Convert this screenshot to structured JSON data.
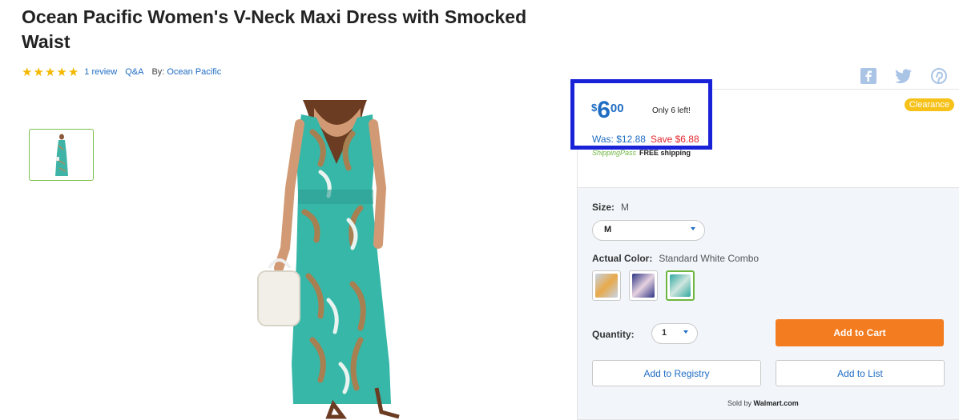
{
  "product": {
    "title": "Ocean Pacific Women's V-Neck Maxi Dress with Smocked Waist",
    "rating": 5,
    "review_link": "1 review",
    "qa_link": "Q&A",
    "by_label": "By:",
    "brand": "Ocean Pacific"
  },
  "social": {
    "icons": [
      "facebook-icon",
      "twitter-icon",
      "pinterest-icon"
    ],
    "color": "#aac4e6"
  },
  "buybox": {
    "badge": "Clearance",
    "price": {
      "currency": "$",
      "dollars": "6",
      "cents": "00"
    },
    "stock_note": "Only 6 left!",
    "was_price": "Was: $12.88",
    "savings": "Save $6.88",
    "shipping_brand": "ShippingPass",
    "shipping_text": "FREE shipping",
    "size_label": "Size:",
    "size_value": "M",
    "size_selected": "M",
    "color_label": "Actual Color:",
    "color_value": "Standard White Combo",
    "swatches": [
      {
        "colors": [
          "#c5d5e8",
          "#e8a94a"
        ]
      },
      {
        "colors": [
          "#2d3585",
          "#e6d2e0"
        ]
      },
      {
        "colors": [
          "#2fa9a0",
          "#cfe6df"
        ]
      }
    ],
    "selected_swatch": 2,
    "quantity_label": "Quantity:",
    "quantity_value": "1",
    "add_to_cart": "Add to Cart",
    "add_to_registry": "Add to Registry",
    "add_to_list": "Add to List",
    "sold_by_label": "Sold by",
    "seller": "Walmart.com"
  },
  "colors": {
    "accent_blue": "#1f6dc2",
    "cart_orange": "#f47c20",
    "save_red": "#e1262c",
    "highlight_border": "#1a22d8",
    "selected_green": "#6eb640"
  }
}
